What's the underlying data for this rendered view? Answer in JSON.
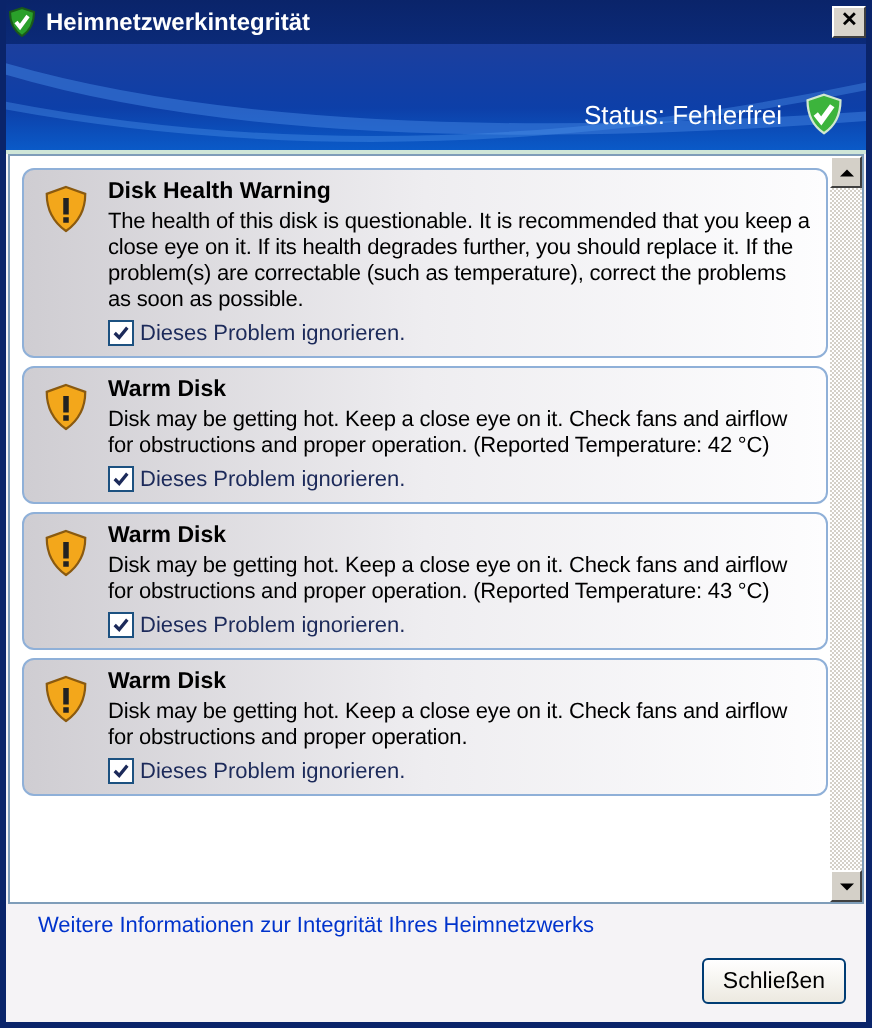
{
  "window": {
    "title": "Heimnetzwerkintegrität",
    "close": "✕"
  },
  "banner": {
    "status": "Status: Fehlerfrei"
  },
  "problems": [
    {
      "title": "Disk Health Warning",
      "text": "The health of this disk is questionable. It is recommended that you keep a close eye on it. If its health degrades further, you should replace it. If the problem(s) are correctable (such as temperature), correct the problems as soon as possible.",
      "ignore_label": "Dieses Problem ignorieren.",
      "checked": true
    },
    {
      "title": "Warm Disk",
      "text": "Disk may be getting hot. Keep a close eye on it. Check fans and airflow for obstructions and proper operation. (Reported Temperature: 42 °C)",
      "ignore_label": "Dieses Problem ignorieren.",
      "checked": true
    },
    {
      "title": "Warm Disk",
      "text": "Disk may be getting hot. Keep a close eye on it. Check fans and airflow for obstructions and proper operation. (Reported Temperature: 43 °C)",
      "ignore_label": "Dieses Problem ignorieren.",
      "checked": true
    },
    {
      "title": "Warm Disk",
      "text": "Disk may be getting hot. Keep a close eye on it. Check fans and airflow for obstructions and proper operation.",
      "ignore_label": "Dieses Problem ignorieren.",
      "checked": true
    }
  ],
  "link": "Weitere Informationen zur Integrität Ihres Heimnetzwerks",
  "buttons": [
    "Schließen"
  ]
}
